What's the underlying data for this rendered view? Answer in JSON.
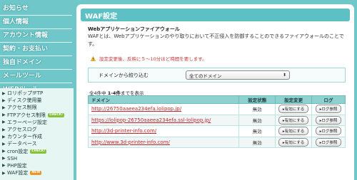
{
  "sidebar": {
    "headers": [
      "お知らせ",
      "個人情報",
      "アカウント情報",
      "契約・お支払い",
      "独自ドメイン",
      "メールツール",
      "WEBツール"
    ],
    "sub_items": [
      {
        "label": "ロリポップ!FTP"
      },
      {
        "label": "ディスク使用量"
      },
      {
        "label": "アクセス制限"
      },
      {
        "label": "FTPアクセス制限",
        "badge": "CHECK!"
      },
      {
        "label": "エラーページ設定"
      },
      {
        "label": "アクセスログ"
      },
      {
        "label": "カウンター作成"
      },
      {
        "label": "データベース"
      },
      {
        "label": "cron設定",
        "badge": "CHECK!"
      },
      {
        "label": "SSH"
      },
      {
        "label": "PHP設定"
      },
      {
        "label": "WAF設定",
        "badge": "NEW"
      }
    ]
  },
  "main": {
    "title": "WAF設定",
    "desc_title": "Webアプリケーションファイアウォール",
    "desc_body": "WAFとは、Webアプリケーションのやり取りにおいて不正侵入を防御することのできるファイアウォールのことです。",
    "warning": "設定変更後、反映に５〜10分ほど時間を要します。",
    "filter_label": "ドメインから絞り込む",
    "filter_value": "全てのドメイン",
    "count_prefix": "全4件中 ",
    "count_range": "1-4件",
    "count_suffix": "までを表示",
    "columns": [
      "ドメイン",
      "設定状態",
      "設定変更",
      "ログ"
    ],
    "rows": [
      {
        "domain": "http://26750aaeea234efa.lolipop.jp/",
        "status": "無効",
        "change": "▸有効にする",
        "log": "▸ログ参照"
      },
      {
        "domain": "https://lolipop-26750aaeea234efa.ssl-lolipop.jp/",
        "status": "無効",
        "change": "▸有効にする",
        "log": "▸ログ参照"
      },
      {
        "domain": "http://3d-printer-info.com/",
        "status": "無効",
        "change": "▸有効にする",
        "log": "▸ログ参照"
      },
      {
        "domain": "http://www.3d-printer-info.com/",
        "status": "無効",
        "change": "▸有効にする",
        "log": "▸ログ参照"
      }
    ]
  },
  "colors": {
    "background": "#6fc7c9",
    "panel_header": "#5cc0c4",
    "link": "#c0282d",
    "warning": "#c23b3b",
    "badge_check": "#88c23a",
    "badge_new": "#e9962c"
  },
  "icons": {
    "warning": "warning-triangle-icon",
    "sub_item_arrow": "triangle-right-icon",
    "select_caret": "updown-caret-icon"
  }
}
